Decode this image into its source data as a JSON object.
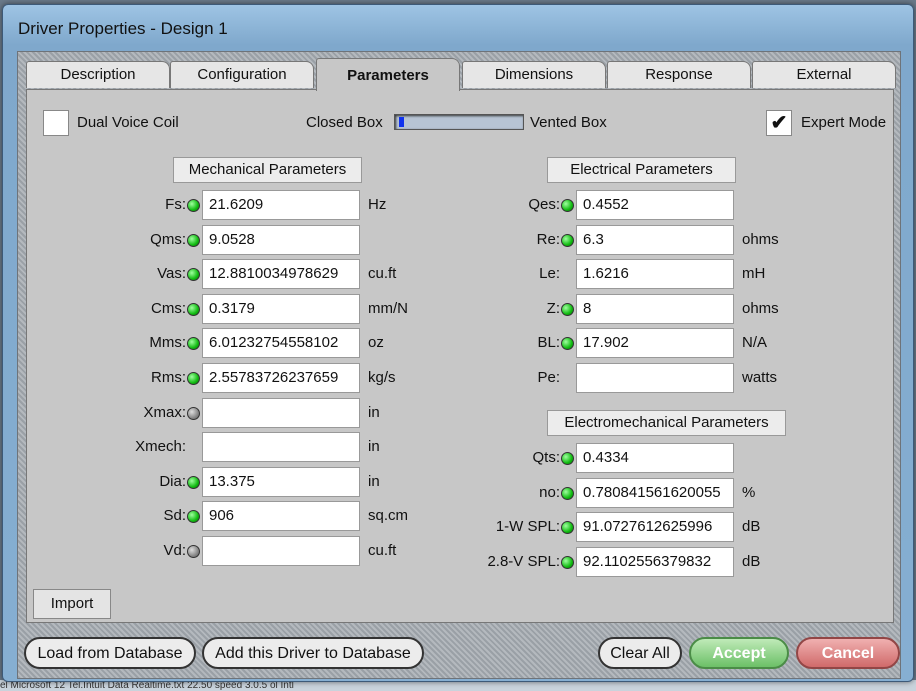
{
  "window": {
    "title": "Driver Properties - Design 1"
  },
  "tabs": [
    "Description",
    "Configuration",
    "Parameters",
    "Dimensions",
    "Response",
    "External"
  ],
  "active_tab": "Parameters",
  "options": {
    "dual_voice_coil_label": "Dual Voice Coil",
    "dual_voice_coil_checked": false,
    "closed_box_label": "Closed Box",
    "vented_box_label": "Vented Box",
    "box_type_slider_level": 0.02,
    "expert_mode_label": "Expert Mode",
    "expert_mode_checked": true,
    "expert_mode_check": "✔"
  },
  "mechanical": {
    "header": "Mechanical Parameters",
    "rows": [
      {
        "label": "Fs:",
        "led": "green",
        "value": "21.6209",
        "unit": "Hz"
      },
      {
        "label": "Qms:",
        "led": "green",
        "value": "9.0528",
        "unit": ""
      },
      {
        "label": "Vas:",
        "led": "green",
        "value": "12.8810034978629",
        "unit": "cu.ft"
      },
      {
        "label": "Cms:",
        "led": "green",
        "value": "0.3179",
        "unit": "mm/N"
      },
      {
        "label": "Mms:",
        "led": "green",
        "value": "6.01232754558102",
        "unit": "oz"
      },
      {
        "label": "Rms:",
        "led": "green",
        "value": "2.55783726237659",
        "unit": "kg/s"
      },
      {
        "label": "Xmax:",
        "led": "gray",
        "value": "",
        "unit": "in"
      },
      {
        "label": "Xmech:",
        "led": "none",
        "value": "",
        "unit": "in"
      },
      {
        "label": "Dia:",
        "led": "green",
        "value": "13.375",
        "unit": "in"
      },
      {
        "label": "Sd:",
        "led": "green",
        "value": "906",
        "unit": "sq.cm"
      },
      {
        "label": "Vd:",
        "led": "gray",
        "value": "",
        "unit": "cu.ft"
      }
    ]
  },
  "electrical": {
    "header": "Electrical Parameters",
    "rows": [
      {
        "label": "Qes:",
        "led": "green",
        "value": "0.4552",
        "unit": ""
      },
      {
        "label": "Re:",
        "led": "green",
        "value": "6.3",
        "unit": "ohms"
      },
      {
        "label": "Le:",
        "led": "none",
        "value": "1.6216",
        "unit": "mH"
      },
      {
        "label": "Z:",
        "led": "green",
        "value": "8",
        "unit": "ohms"
      },
      {
        "label": "BL:",
        "led": "green",
        "value": "17.902",
        "unit": "N/A"
      },
      {
        "label": "Pe:",
        "led": "none",
        "value": "",
        "unit": "watts"
      }
    ]
  },
  "electromechanical": {
    "header": "Electromechanical Parameters",
    "rows": [
      {
        "label": "Qts:",
        "led": "green",
        "value": "0.4334",
        "unit": ""
      },
      {
        "label": "no:",
        "led": "green",
        "value": "0.780841561620055",
        "unit": "%"
      },
      {
        "label": "1-W SPL:",
        "led": "green",
        "value": "91.0727612625996",
        "unit": "dB"
      },
      {
        "label": "2.8-V SPL:",
        "led": "green",
        "value": "92.1102556379832",
        "unit": "dB"
      }
    ]
  },
  "buttons": {
    "import": "Import",
    "load_db": "Load from Database",
    "add_db": "Add this Driver to Database",
    "clear_all": "Clear All",
    "accept": "Accept",
    "cancel": "Cancel"
  },
  "taskbar_text": "el      Microsoft 12     Tel.Intuit           Data              Realtime.txt     22.50 speed    3.0.5 ol   Intl"
}
